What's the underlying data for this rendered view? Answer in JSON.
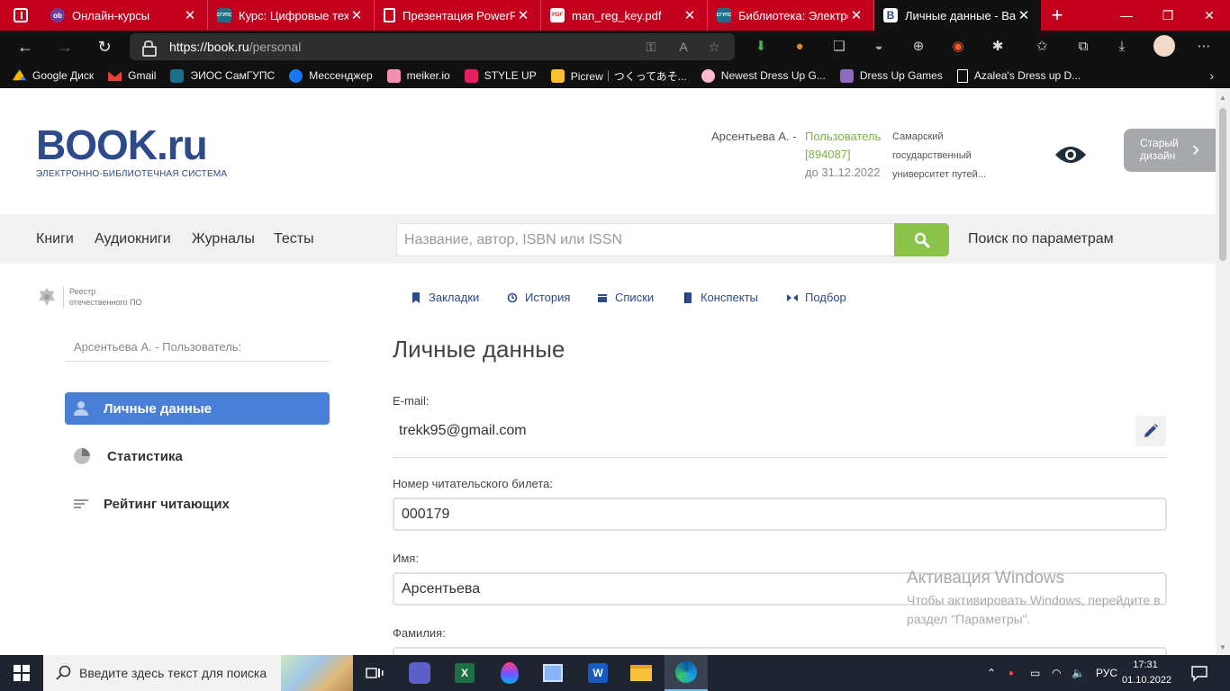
{
  "browser": {
    "tabs": [
      {
        "title": "Онлайн-курсы",
        "favicon_color": "#6a3fa0",
        "favicon_text": "оb"
      },
      {
        "title": "Курс: Цифровые техн",
        "favicon_color": "#1a6f8a",
        "favicon_text": "СГУПС"
      },
      {
        "title": "Презентация PowerPo",
        "favicon_color": "#ffffff",
        "favicon_text": ""
      },
      {
        "title": "man_reg_key.pdf",
        "favicon_color": "#d32f2f",
        "favicon_text": "PDF"
      },
      {
        "title": "Библиотека: Электрон",
        "favicon_color": "#1a6f8a",
        "favicon_text": "СГУПС"
      },
      {
        "title": "Личные данные - Ваш",
        "favicon_color": "#2d4a8a",
        "favicon_text": "B"
      }
    ],
    "address": {
      "host": "https://book.ru",
      "path": "/personal"
    },
    "bookmarks": [
      {
        "label": "Google Диск",
        "color": "#f4b400"
      },
      {
        "label": "Gmail",
        "color": "#ea4335"
      },
      {
        "label": "ЭИОС СамГУПС",
        "color": "#1a6f8a"
      },
      {
        "label": "Мессенджер",
        "color": "#1877f2"
      },
      {
        "label": "meiker.io",
        "color": "#f48fb1"
      },
      {
        "label": "STYLE UP",
        "color": "#e91e63"
      },
      {
        "label": "Picrew｜つくってあそ...",
        "color": "#fbc02d"
      },
      {
        "label": "Newest Dress Up G...",
        "color": "#f8bbd0"
      },
      {
        "label": "Dress Up Games",
        "color": "#8e6cbf"
      },
      {
        "label": "Azalea's Dress up D...",
        "color": "#ffffff"
      }
    ]
  },
  "site": {
    "logo": {
      "main": "BOOK.ru",
      "sub": "ЭЛЕКТРОННО-БИБЛИОТЕЧНАЯ СИСТЕМА"
    },
    "user": {
      "name": "Арсентьева А. -",
      "role": "Пользователь",
      "id": "[894087]",
      "valid_until": "до 31.12.2022",
      "org_lines": [
        "Самарский",
        "государственный",
        "университет путей..."
      ]
    },
    "old_design": {
      "line1": "Старый",
      "line2": "дизайн"
    },
    "nav": [
      "Книги",
      "Аудиокниги",
      "Журналы",
      "Тесты"
    ],
    "search": {
      "placeholder": "Название, автор, ISBN или ISSN"
    },
    "param_search": "Поиск по параметрам",
    "reestr": {
      "line1": "Реестр",
      "line2": "отечественного ПО"
    },
    "sidebar": {
      "user_label": "Арсентьева А. - Пользователь:",
      "items": [
        {
          "label": "Личные данные"
        },
        {
          "label": "Статистика"
        },
        {
          "label": "Рейтинг читающих"
        }
      ]
    },
    "content_tabs": [
      "Закладки",
      "История",
      "Списки",
      "Конспекты",
      "Подбор"
    ],
    "page_title": "Личные данные",
    "fields": {
      "email_label": "E-mail:",
      "email_value": "trekk95@gmail.com",
      "card_label": "Номер читательского билета:",
      "card_value": "000179",
      "firstname_label": "Имя:",
      "firstname_value": "Арсентьева",
      "lastname_label": "Фамилия:"
    },
    "accent_color": "#4a7fd8",
    "search_button_color": "#8bc34a"
  },
  "watermark": {
    "title": "Активация Windows",
    "line1": "Чтобы активировать Windows, перейдите в",
    "line2": "раздел \"Параметры\"."
  },
  "taskbar": {
    "search_placeholder": "Введите здесь текст для поиска",
    "lang": "РУС",
    "time": "17:31",
    "date": "01.10.2022"
  }
}
